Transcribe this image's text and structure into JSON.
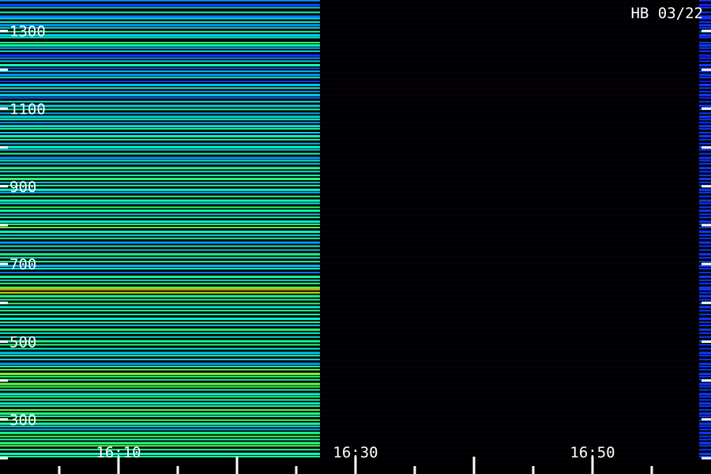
{
  "chart_data": {
    "type": "heatmap",
    "title": "HB 03/22",
    "xlabel": "",
    "ylabel": "",
    "x_ticks": [
      "16:10",
      "16:30",
      "16:50"
    ],
    "x_range": [
      "16:00",
      "17:00"
    ],
    "y_ticks": [
      300,
      500,
      700,
      900,
      1100,
      1300
    ],
    "y_range": [
      200,
      1400
    ],
    "segments": [
      {
        "start": "16:00",
        "end": "16:27",
        "state": "data"
      },
      {
        "start": "16:27",
        "end": "16:59",
        "state": "no signal"
      },
      {
        "start": "16:59",
        "end": "17:00",
        "state": "data"
      }
    ],
    "colormap": [
      "#2a00ff",
      "#0050ff",
      "#00a8ff",
      "#00ffd0",
      "#30ff60",
      "#c8ff00",
      "#ff7000"
    ],
    "spectrum": [
      [
        1395,
        0.08
      ],
      [
        1388,
        0.45
      ],
      [
        1380,
        0.3
      ],
      [
        1370,
        0.15
      ],
      [
        1362,
        0.4
      ],
      [
        1350,
        0.55
      ],
      [
        1340,
        0.25
      ],
      [
        1334,
        0.42
      ],
      [
        1325,
        0.5
      ],
      [
        1318,
        0.3
      ],
      [
        1310,
        0.45
      ],
      [
        1300,
        0.55
      ],
      [
        1292,
        0.4
      ],
      [
        1285,
        0.48
      ],
      [
        1272,
        0.62
      ],
      [
        1266,
        0.55
      ],
      [
        1258,
        0.35
      ],
      [
        1250,
        0.45
      ],
      [
        1240,
        0.1
      ],
      [
        1232,
        0.3
      ],
      [
        1224,
        0.42
      ],
      [
        1215,
        0.55
      ],
      [
        1206,
        0.18
      ],
      [
        1198,
        0.4
      ],
      [
        1190,
        0.3
      ],
      [
        1182,
        0.46
      ],
      [
        1172,
        0.12
      ],
      [
        1164,
        0.38
      ],
      [
        1155,
        0.5
      ],
      [
        1146,
        0.3
      ],
      [
        1138,
        0.42
      ],
      [
        1130,
        0.2
      ],
      [
        1120,
        0.48
      ],
      [
        1110,
        0.4
      ],
      [
        1100,
        0.55
      ],
      [
        1090,
        0.35
      ],
      [
        1082,
        0.42
      ],
      [
        1074,
        0.52
      ],
      [
        1066,
        0.3
      ],
      [
        1058,
        0.45
      ],
      [
        1050,
        0.58
      ],
      [
        1040,
        0.4
      ],
      [
        1032,
        0.48
      ],
      [
        1022,
        0.55
      ],
      [
        1012,
        0.36
      ],
      [
        1004,
        0.5
      ],
      [
        996,
        0.42
      ],
      [
        986,
        0.55
      ],
      [
        976,
        0.3
      ],
      [
        968,
        0.48
      ],
      [
        960,
        0.4
      ],
      [
        950,
        0.58
      ],
      [
        940,
        0.45
      ],
      [
        930,
        0.52
      ],
      [
        922,
        0.62
      ],
      [
        912,
        0.4
      ],
      [
        904,
        0.56
      ],
      [
        894,
        0.48
      ],
      [
        886,
        0.35
      ],
      [
        876,
        0.6
      ],
      [
        866,
        0.52
      ],
      [
        858,
        0.45
      ],
      [
        848,
        0.66
      ],
      [
        840,
        0.55
      ],
      [
        830,
        0.4
      ],
      [
        822,
        0.58
      ],
      [
        812,
        0.48
      ],
      [
        804,
        0.62
      ],
      [
        796,
        0.72
      ],
      [
        786,
        0.5
      ],
      [
        776,
        0.44
      ],
      [
        768,
        0.58
      ],
      [
        758,
        0.3
      ],
      [
        748,
        0.52
      ],
      [
        738,
        0.4
      ],
      [
        728,
        0.6
      ],
      [
        718,
        0.48
      ],
      [
        708,
        0.56
      ],
      [
        698,
        0.35
      ],
      [
        690,
        0.5
      ],
      [
        680,
        0.25
      ],
      [
        670,
        0.58
      ],
      [
        660,
        0.44
      ],
      [
        652,
        0.62
      ],
      [
        642,
        0.7
      ],
      [
        636,
        0.96
      ],
      [
        628,
        0.85
      ],
      [
        620,
        0.6
      ],
      [
        610,
        0.55
      ],
      [
        600,
        0.66
      ],
      [
        592,
        0.45
      ],
      [
        582,
        0.62
      ],
      [
        572,
        0.55
      ],
      [
        562,
        0.48
      ],
      [
        552,
        0.58
      ],
      [
        544,
        0.4
      ],
      [
        534,
        0.62
      ],
      [
        524,
        0.5
      ],
      [
        514,
        0.45
      ],
      [
        504,
        0.58
      ],
      [
        494,
        0.62
      ],
      [
        484,
        0.5
      ],
      [
        474,
        0.38
      ],
      [
        466,
        0.55
      ],
      [
        456,
        0.44
      ],
      [
        446,
        0.3
      ],
      [
        438,
        0.6
      ],
      [
        430,
        0.7
      ],
      [
        420,
        0.75
      ],
      [
        412,
        0.62
      ],
      [
        404,
        0.58
      ],
      [
        394,
        0.72
      ],
      [
        386,
        0.66
      ],
      [
        378,
        0.55
      ],
      [
        368,
        0.48
      ],
      [
        360,
        0.62
      ],
      [
        352,
        0.58
      ],
      [
        344,
        0.45
      ],
      [
        336,
        0.6
      ],
      [
        326,
        0.7
      ],
      [
        318,
        0.62
      ],
      [
        310,
        0.55
      ],
      [
        300,
        0.66
      ],
      [
        292,
        0.58
      ],
      [
        284,
        0.45
      ],
      [
        276,
        0.35
      ],
      [
        268,
        0.6
      ],
      [
        258,
        0.68
      ],
      [
        250,
        0.55
      ],
      [
        242,
        0.62
      ],
      [
        234,
        0.7
      ],
      [
        224,
        0.58
      ],
      [
        214,
        0.5
      ],
      [
        206,
        0.62
      ]
    ],
    "grid": false,
    "legend": "none"
  }
}
